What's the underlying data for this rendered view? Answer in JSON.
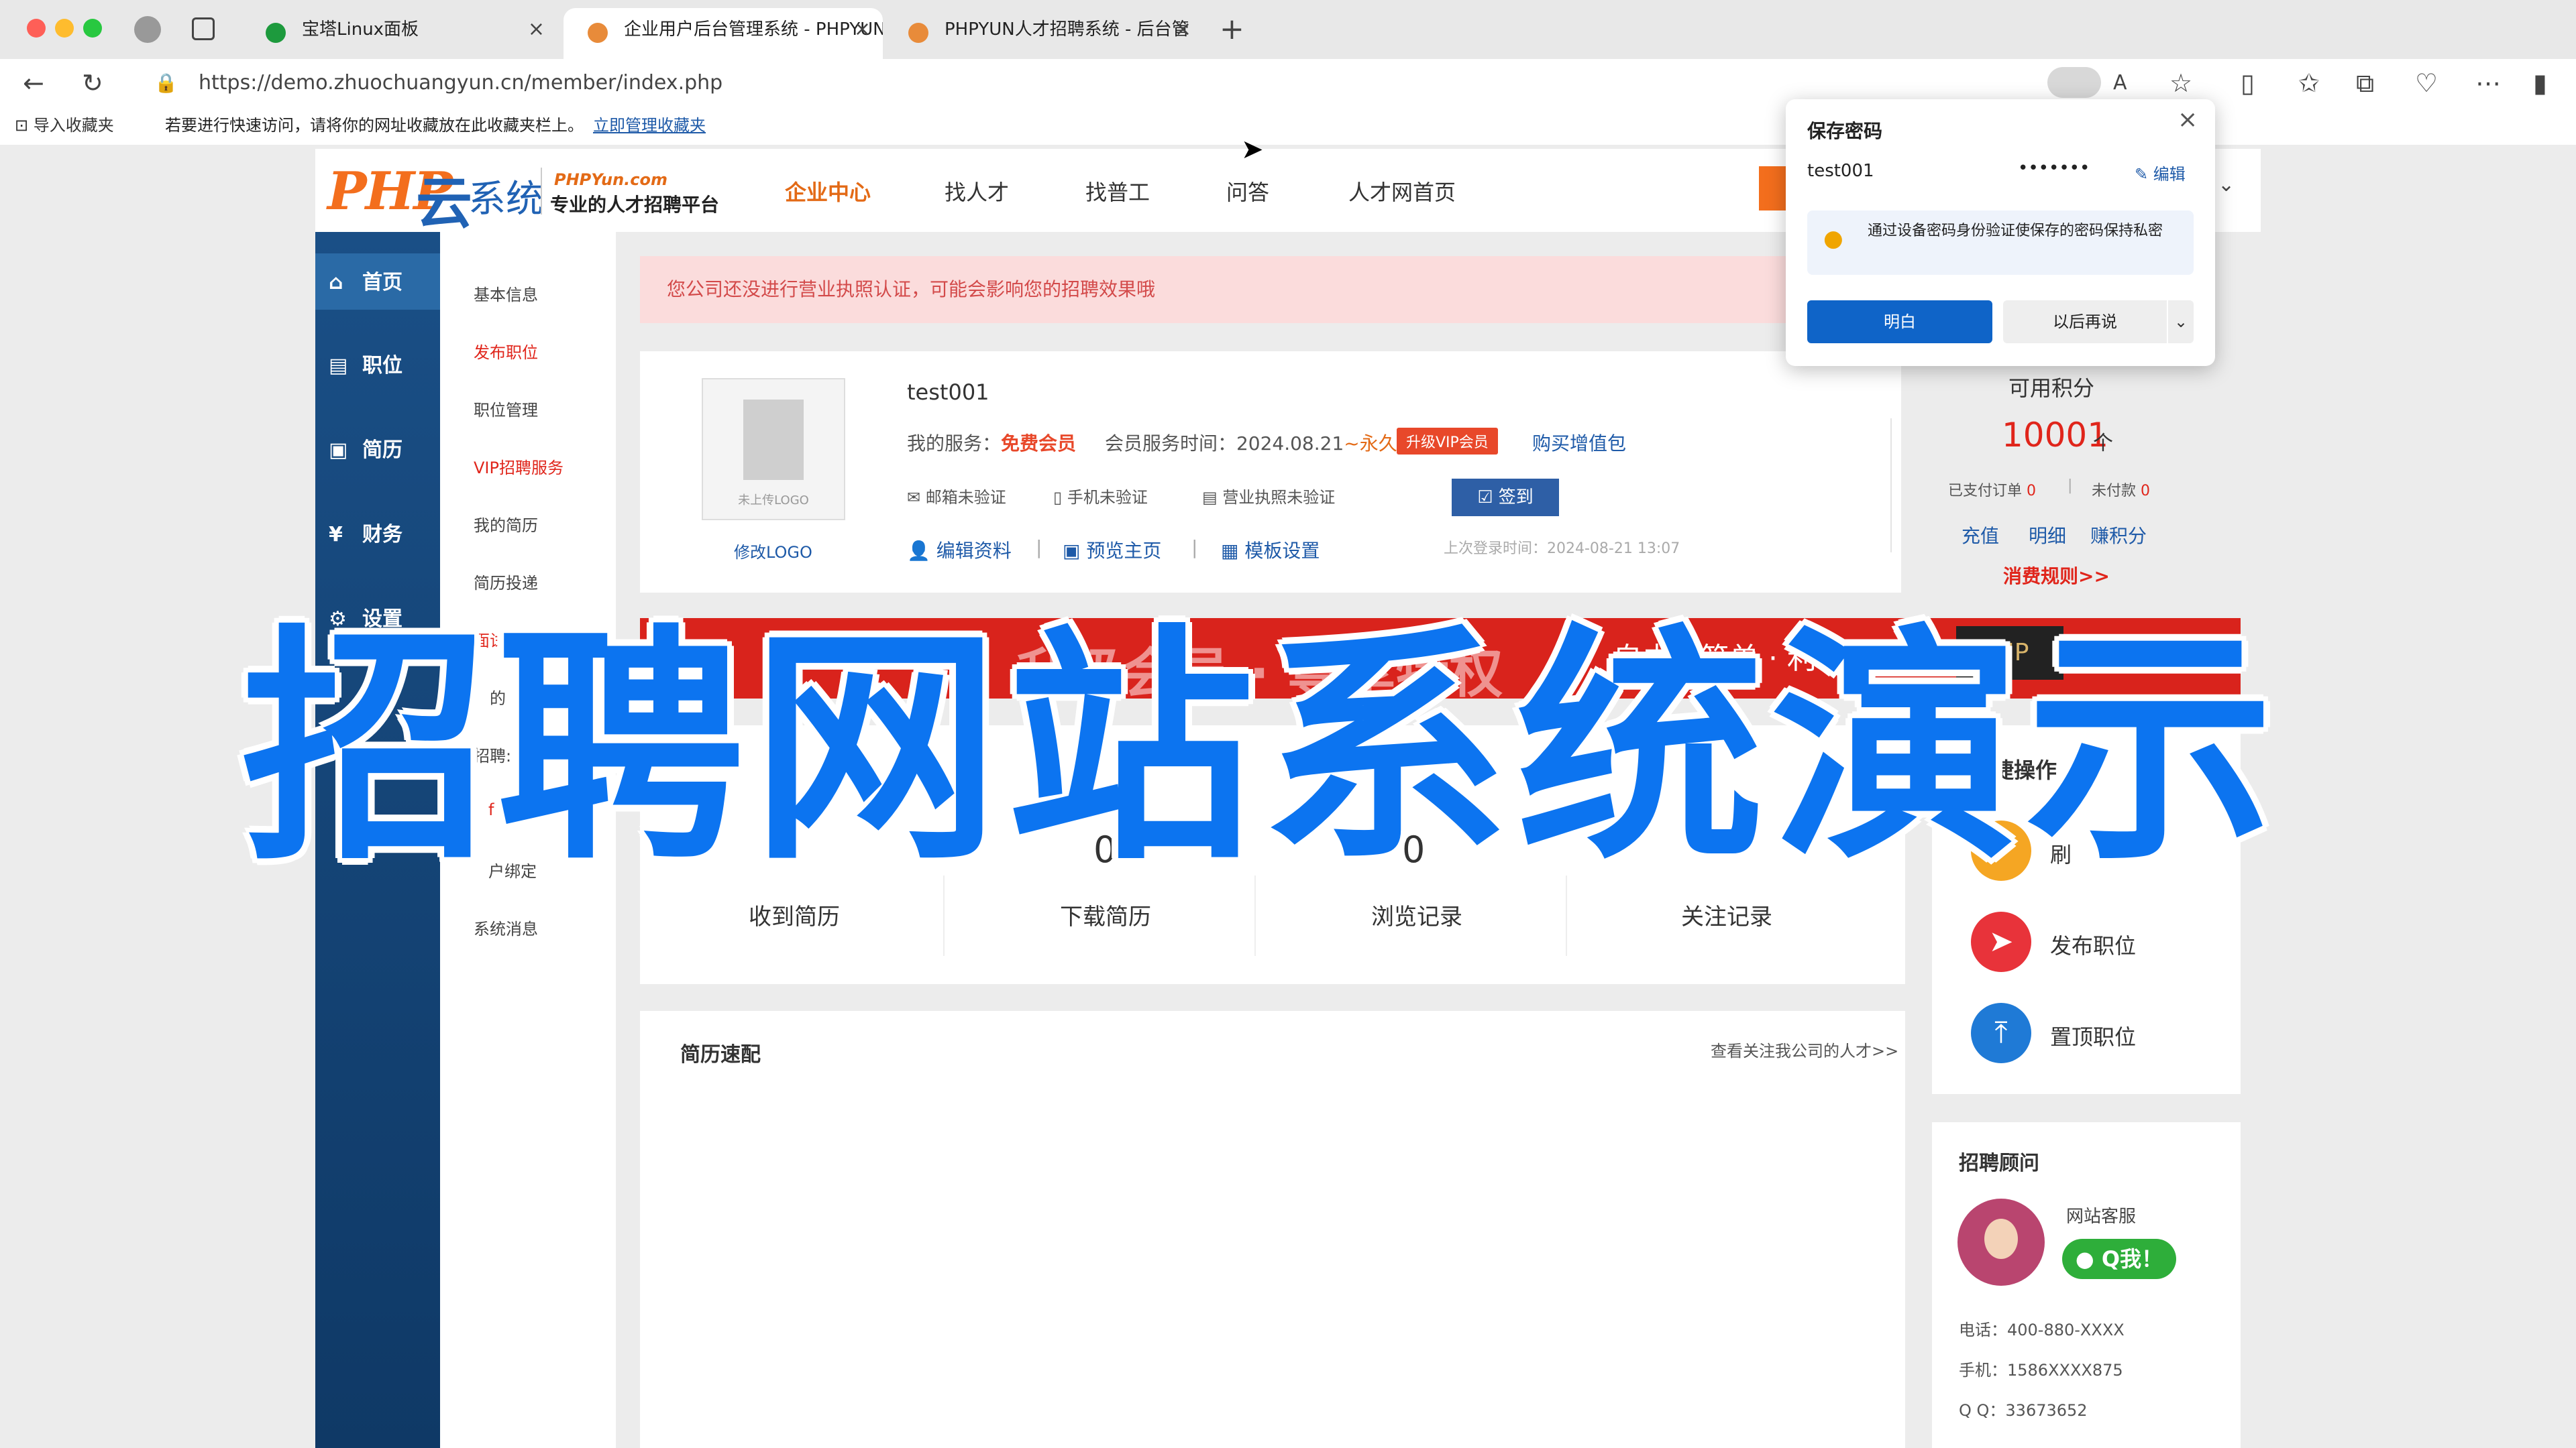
{
  "browser": {
    "tabs": [
      {
        "title": "宝塔Linux面板",
        "favicon_color": "#1d9a3d"
      },
      {
        "title": "企业用户后台管理系统 - PHPYUN",
        "favicon_color": "#e88b3a"
      },
      {
        "title": "PHPYUN人才招聘系统 - 后台管",
        "favicon_color": "#e88b3a"
      }
    ],
    "url": "https://demo.zhuochuangyun.cn/member/index.php",
    "favbar": {
      "import_label": "导入收藏夹",
      "hint": "若要进行快速访问，请将你的网址收藏放在此收藏夹栏上。",
      "manage_link": "立即管理收藏夹"
    }
  },
  "password_popup": {
    "title": "保存密码",
    "username": "test001",
    "password_mask": "•••••••",
    "edit_label": "编辑",
    "tip": "通过设备密码身份验证使保存的密码保持私密",
    "confirm_label": "明白",
    "later_label": "以后再说"
  },
  "site": {
    "logo": {
      "php": "PHP",
      "yun": "云",
      "xitong": "系统",
      "domain": "PHPYun.com",
      "slogan": "专业的人才招聘平台"
    },
    "nav": [
      "企业中心",
      "找人才",
      "找普工",
      "问答",
      "人才网首页"
    ],
    "nav_active": "企业中心"
  },
  "sidebar": {
    "items": [
      {
        "label": "首页",
        "icon": "home-icon"
      },
      {
        "label": "职位",
        "icon": "briefcase-icon"
      },
      {
        "label": "简历",
        "icon": "id-card-icon"
      },
      {
        "label": "财务",
        "icon": "finance-icon"
      },
      {
        "label": "设置",
        "icon": "gear-icon"
      }
    ],
    "sub_items": [
      {
        "label": "基本信息",
        "highlight": false
      },
      {
        "label": "发布职位",
        "highlight": true
      },
      {
        "label": "职位管理",
        "highlight": false
      },
      {
        "label": "VIP招聘服务",
        "highlight": true
      },
      {
        "label": "我的简历",
        "highlight": false
      },
      {
        "label": "简历投递",
        "highlight": false
      },
      {
        "label": "面试邀请",
        "highlight": true
      },
      {
        "label": "的",
        "highlight": false
      },
      {
        "label": "招聘:",
        "highlight": false
      },
      {
        "label": "f",
        "highlight": true
      },
      {
        "label": "户绑定",
        "highlight": false
      },
      {
        "label": "系统消息",
        "highlight": false
      }
    ]
  },
  "alert": "您公司还没进行营业执照认证，可能会影响您的招聘效果哦",
  "profile": {
    "logo_placeholder": "未上传LOGO",
    "edit_logo": "修改LOGO",
    "username": "test001",
    "service_label": "我的服务：",
    "service_value": "免费会员",
    "time_label": "会员服务时间：",
    "time_value": "2024.08.21",
    "time_forever": "~永久",
    "upgrade_label": "升级VIP会员",
    "buy_label": "购买增值包",
    "verify": [
      "邮箱未验证",
      "手机未验证",
      "营业执照未验证"
    ],
    "signin_label": "签到",
    "links": [
      "编辑资料",
      "预览主页",
      "模板设置"
    ],
    "last_login": "上次登录时间：2024-08-21 13:07"
  },
  "points": {
    "title": "可用积分",
    "value": "10001",
    "unit": "个",
    "paid_label": "已支付订单",
    "paid_value": "0",
    "unpaid_label": "未付款",
    "unpaid_value": "0",
    "actions": [
      "充值",
      "明细",
      "赚积分"
    ],
    "rules": "消费规则>>"
  },
  "banner": {
    "text": "升级会员 · 尊享特权",
    "text2": "自由 · 简单 · 利",
    "badge": "VIP"
  },
  "stats": [
    {
      "value": "0",
      "label": "收到简历"
    },
    {
      "value": "0",
      "label": "下载简历"
    },
    {
      "value": "0",
      "label": "浏览记录"
    },
    {
      "value": "0",
      "label": "关注记录"
    }
  ],
  "quick": {
    "title": "捷操作",
    "items": [
      {
        "label": "刷",
        "color": "#f5a623"
      },
      {
        "label": "发布职位",
        "color": "#e8333a"
      },
      {
        "label": "置顶职位",
        "color": "#1f7ad6"
      }
    ]
  },
  "resume_match": {
    "title": "简历速配",
    "link": "查看关注我公司的人才>>"
  },
  "advisor": {
    "title": "招聘顾问",
    "name": "网站客服",
    "qq_btn": "Q我！",
    "phone": "电话：400-880-XXXX",
    "mobile": "手机：1586XXXX875",
    "qq": "Q Q：33673652"
  },
  "overlay_title": "招聘网站系统演示"
}
